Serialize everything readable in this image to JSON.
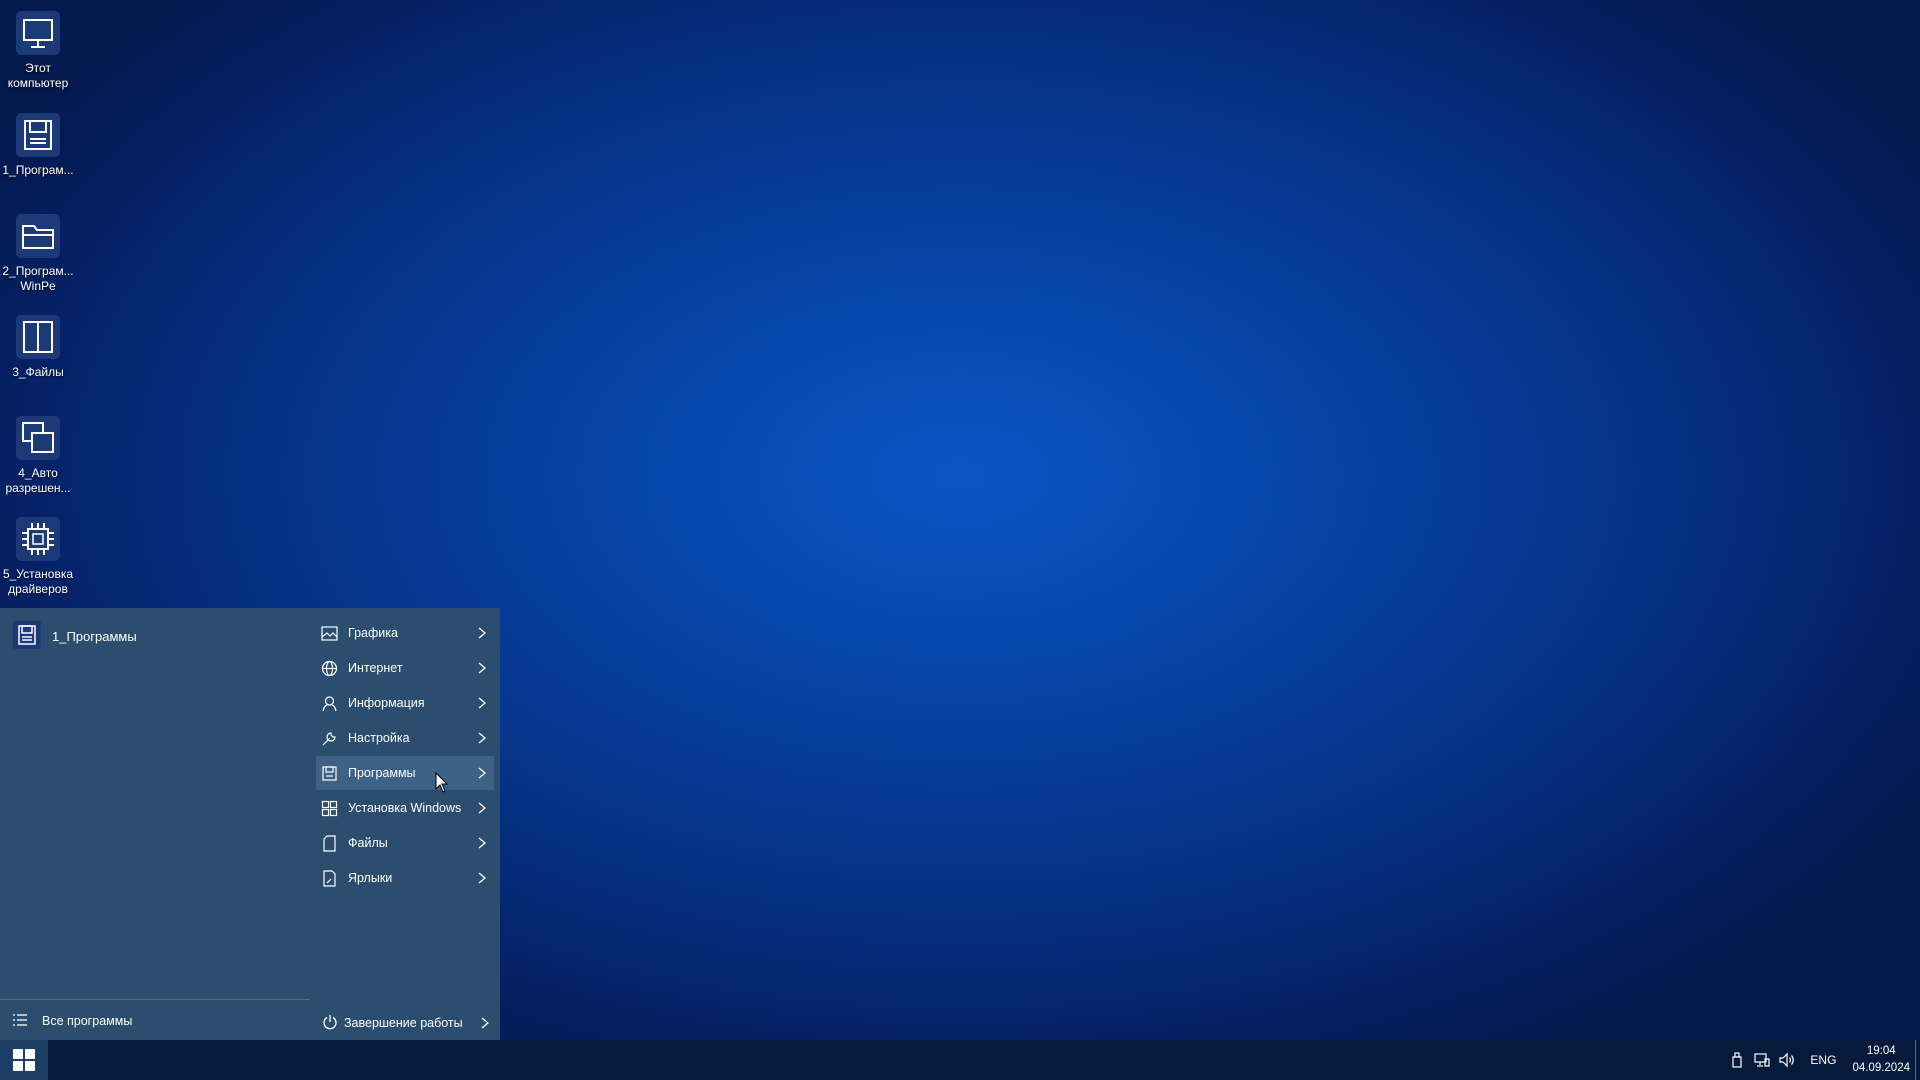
{
  "desktop": {
    "icons": [
      {
        "label": "Этот компьютер",
        "icon": "monitor-icon"
      },
      {
        "label": "1_Програм...",
        "icon": "floppy-disk-icon"
      },
      {
        "label": "2_Програм... WinPe",
        "icon": "folder-icon"
      },
      {
        "label": "3_Файлы",
        "icon": "split-panel-icon"
      },
      {
        "label": "4_Авто разрешен...",
        "icon": "windows-overlap-icon"
      },
      {
        "label": "5_Установка драйверов",
        "icon": "chip-icon"
      }
    ]
  },
  "start_menu": {
    "pinned": {
      "label": "1_Программы",
      "icon": "floppy-disk-icon"
    },
    "categories": [
      {
        "label": "Графика",
        "icon": "image-icon"
      },
      {
        "label": "Интернет",
        "icon": "globe-icon"
      },
      {
        "label": "Информация",
        "icon": "person-info-icon"
      },
      {
        "label": "Настройка",
        "icon": "wrench-icon"
      },
      {
        "label": "Программы",
        "icon": "floppy-disk-icon",
        "active": true
      },
      {
        "label": "Установка Windows",
        "icon": "grid-icon"
      },
      {
        "label": "Файлы",
        "icon": "file-icon"
      },
      {
        "label": "Ярлыки",
        "icon": "shortcut-file-icon"
      }
    ],
    "all_programs_label": "Все программы",
    "shutdown_label": "Завершение работы"
  },
  "taskbar": {
    "language": "ENG",
    "time": "19:04",
    "date": "04.09.2024"
  },
  "colors": {
    "menu_bg": "#2b4e6f",
    "menu_active": "#3d6285",
    "taskbar_bg": "#061b3c",
    "desktop_center": "#0b55c4"
  }
}
